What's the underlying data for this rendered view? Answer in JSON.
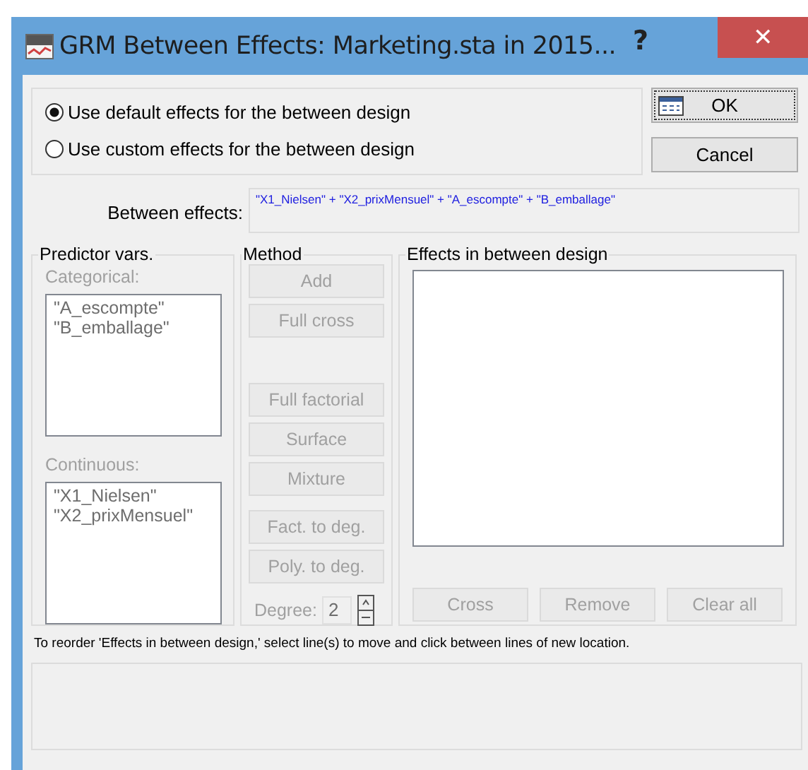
{
  "window": {
    "title": "GRM Between Effects: Marketing.sta in 2015...",
    "help": "?",
    "close": "✕"
  },
  "effect_options": [
    {
      "label": "Use default effects for the between design",
      "selected": true
    },
    {
      "label": "Use custom effects for the between design",
      "selected": false
    }
  ],
  "buttons": [
    {
      "label": "OK",
      "kind": "ok"
    },
    {
      "label": "Cancel",
      "kind": "plain"
    }
  ],
  "between_effects": {
    "label": "Between effects:",
    "value": "\"X1_Nielsen\" + \"X2_prixMensuel\" + \"A_escompte\" + \"B_emballage\""
  },
  "predictor_vars": {
    "title": "Predictor vars.",
    "categorical_label": "Categorical:",
    "categorical": [
      "\"A_escompte\"",
      "\"B_emballage\""
    ],
    "continuous_label": "Continuous:",
    "continuous": [
      "\"X1_Nielsen\"",
      "\"X2_prixMensuel\""
    ]
  },
  "method": {
    "title": "Method",
    "buttons": [
      {
        "label": "Add",
        "disabled": true,
        "gap_before": false
      },
      {
        "label": "Full cross",
        "disabled": true,
        "gap_before": false
      },
      {
        "label": "Full factorial",
        "disabled": true,
        "gap_before": true
      },
      {
        "label": "Surface",
        "disabled": true,
        "gap_before": false
      },
      {
        "label": "Mixture",
        "disabled": true,
        "gap_before": false
      },
      {
        "label": "Fact. to deg.",
        "disabled": true,
        "gap_before": false
      },
      {
        "label": "Poly. to deg.",
        "disabled": true,
        "gap_before": false
      }
    ],
    "degree_label": "Degree:",
    "degree_value": "2",
    "degree_disabled": true
  },
  "effects_design": {
    "title": "Effects in between design",
    "buttons": [
      {
        "label": "Cross",
        "disabled": true
      },
      {
        "label": "Remove",
        "disabled": true
      },
      {
        "label": "Clear all",
        "disabled": true
      }
    ]
  },
  "hint": "To reorder 'Effects in between design,' select line(s) to move and click between lines of new location."
}
